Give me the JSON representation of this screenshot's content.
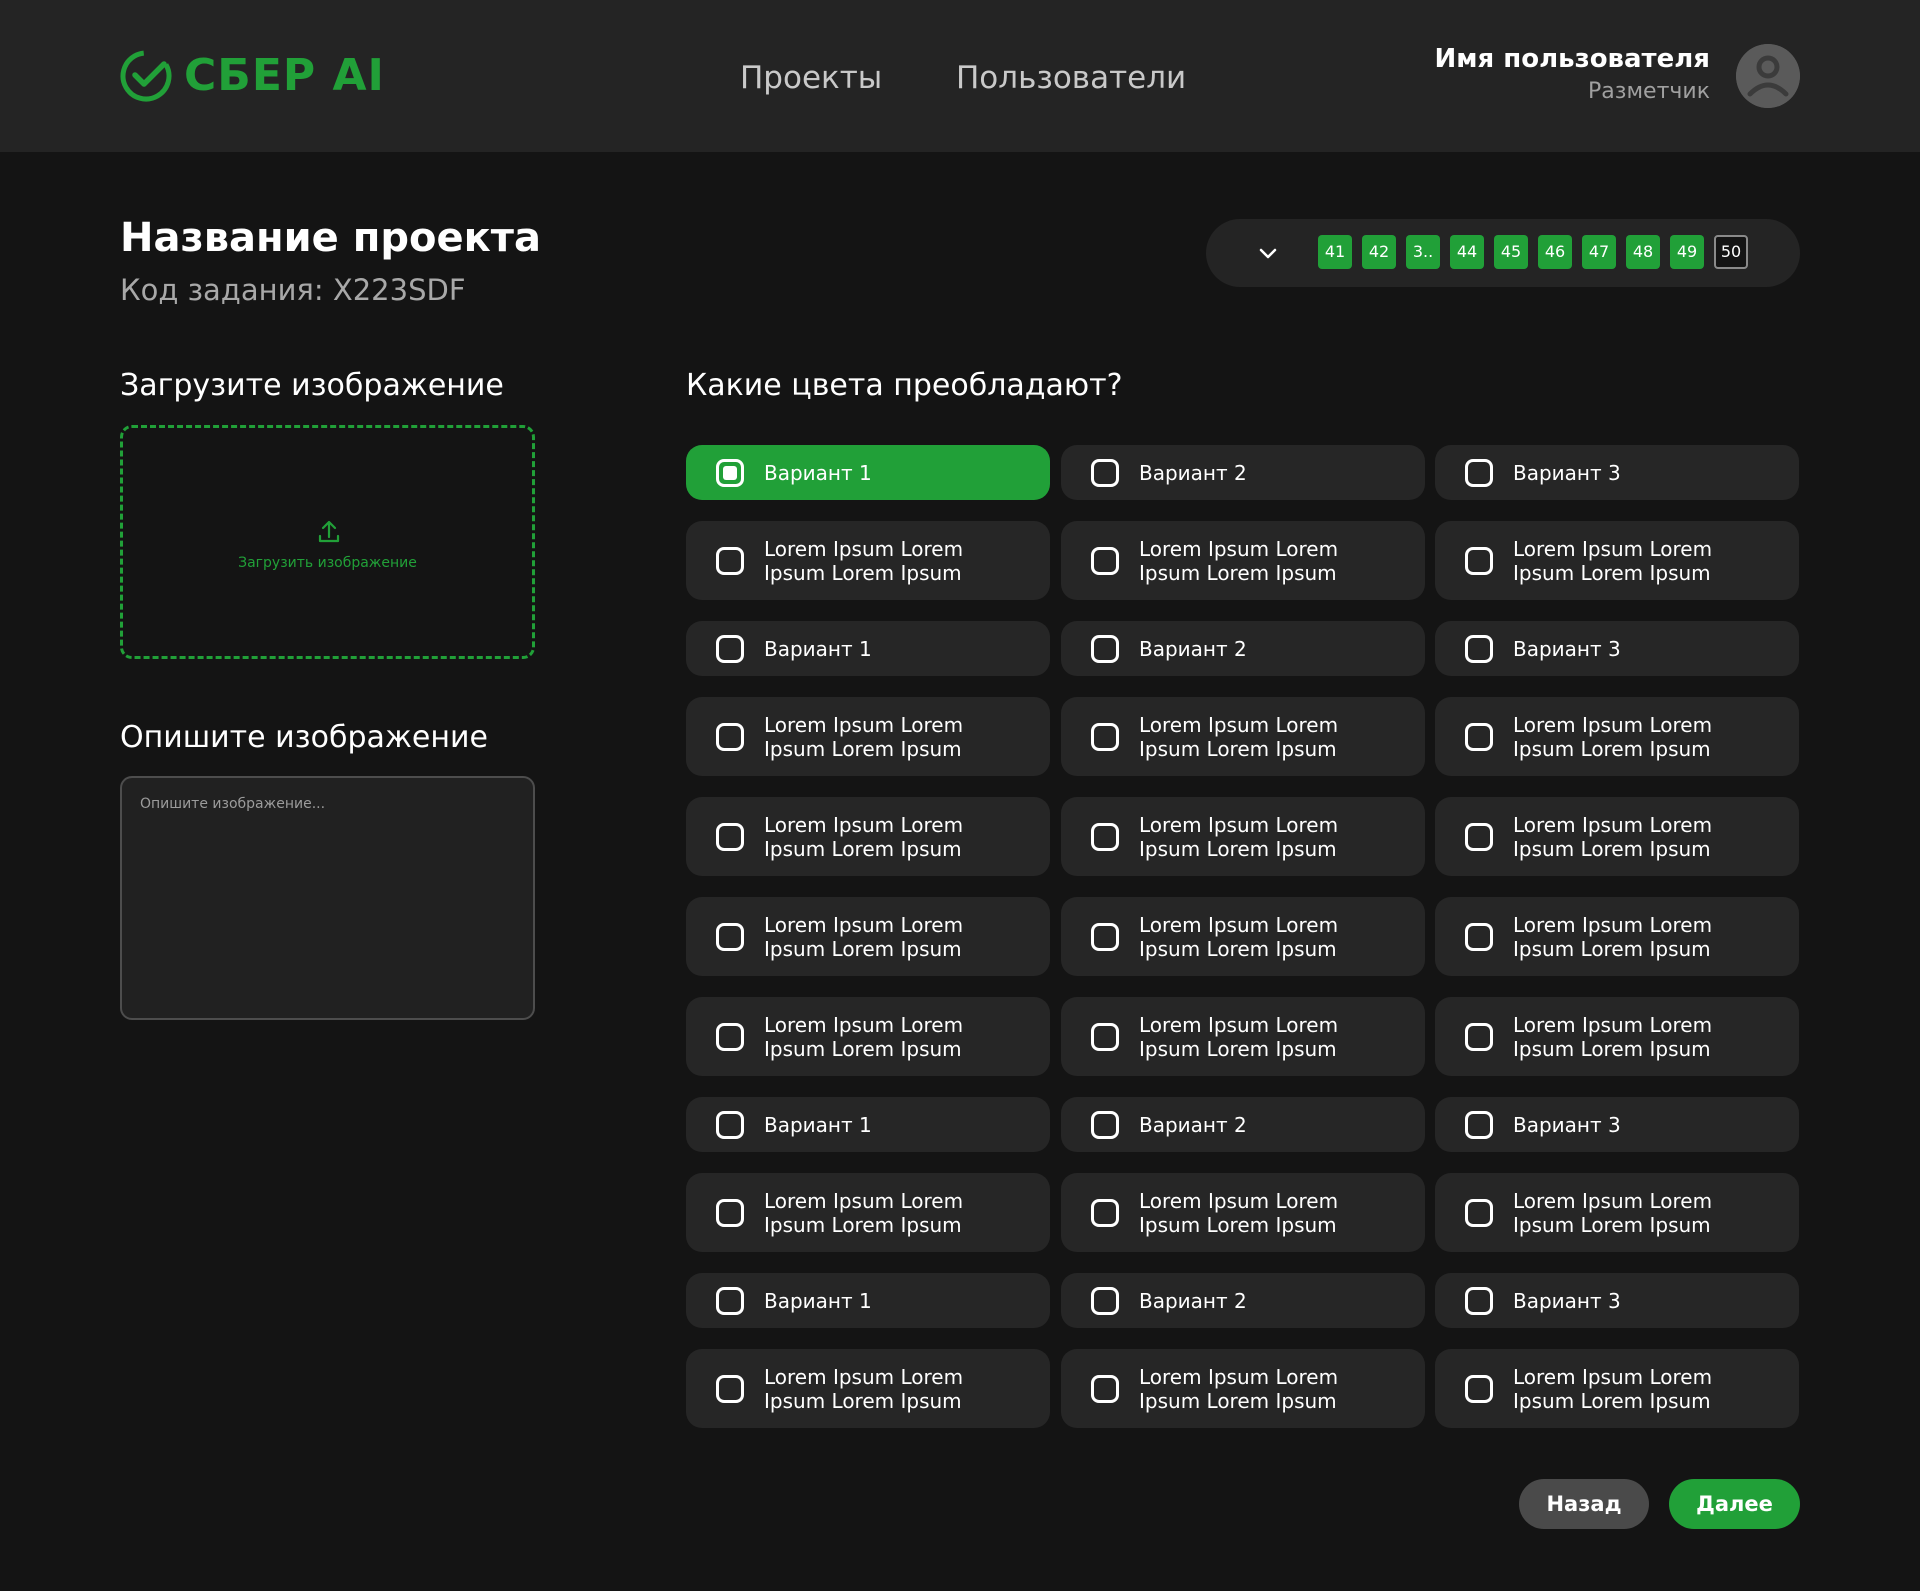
{
  "header": {
    "logo_text": "СБЕР AI",
    "nav": {
      "projects": "Проекты",
      "users": "Пользователи"
    },
    "user": {
      "name": "Имя пользователя",
      "role": "Разметчик"
    }
  },
  "project": {
    "title": "Название проекта",
    "task_code": "Код задания: X223SDF"
  },
  "pagination": {
    "pages": [
      "41",
      "42",
      "3..",
      "44",
      "45",
      "46",
      "47",
      "48",
      "49",
      "50"
    ],
    "current": "50"
  },
  "upload": {
    "label": "Загрузите изображение",
    "button_text": "Загрузить изображение"
  },
  "describe": {
    "label": "Опишите изображение",
    "placeholder": "Опишите изображение..."
  },
  "question": {
    "text": "Какие цвета преобладают?",
    "options": [
      [
        "Вариант 1",
        "Вариант 2",
        "Вариант 3"
      ],
      [
        "Lorem Ipsum Lorem Ipsum Lorem Ipsum",
        "Lorem Ipsum Lorem Ipsum Lorem Ipsum",
        "Lorem Ipsum Lorem Ipsum Lorem Ipsum"
      ],
      [
        "Вариант 1",
        "Вариант 2",
        "Вариант 3"
      ],
      [
        "Lorem Ipsum Lorem Ipsum Lorem Ipsum",
        "Lorem Ipsum Lorem Ipsum Lorem Ipsum",
        "Lorem Ipsum Lorem Ipsum Lorem Ipsum"
      ],
      [
        "Lorem Ipsum Lorem Ipsum Lorem Ipsum",
        "Lorem Ipsum Lorem Ipsum Lorem Ipsum",
        "Lorem Ipsum Lorem Ipsum Lorem Ipsum"
      ],
      [
        "Lorem Ipsum Lorem Ipsum Lorem Ipsum",
        "Lorem Ipsum Lorem Ipsum Lorem Ipsum",
        "Lorem Ipsum Lorem Ipsum Lorem Ipsum"
      ],
      [
        "Lorem Ipsum Lorem Ipsum Lorem Ipsum",
        "Lorem Ipsum Lorem Ipsum Lorem Ipsum",
        "Lorem Ipsum Lorem Ipsum Lorem Ipsum"
      ],
      [
        "Вариант 1",
        "Вариант 2",
        "Вариант 3"
      ],
      [
        "Lorem Ipsum Lorem Ipsum Lorem Ipsum",
        "Lorem Ipsum Lorem Ipsum Lorem Ipsum",
        "Lorem Ipsum Lorem Ipsum Lorem Ipsum"
      ],
      [
        "Вариант 1",
        "Вариант 2",
        "Вариант 3"
      ],
      [
        "Lorem Ipsum Lorem Ipsum Lorem Ipsum",
        "Lorem Ipsum Lorem Ipsum Lorem Ipsum",
        "Lorem Ipsum Lorem Ipsum Lorem Ipsum"
      ]
    ],
    "selected": "Вариант 1"
  },
  "actions": {
    "back": "Назад",
    "next": "Далее"
  },
  "colors": {
    "accent": "#21a038",
    "header_bg": "#242424",
    "page_bg": "#141414",
    "option_bg": "#262626"
  },
  "icons": [
    "sber-logo-icon",
    "chevron-down-icon",
    "upload-icon",
    "user-avatar-icon",
    "checkbox-icon"
  ]
}
